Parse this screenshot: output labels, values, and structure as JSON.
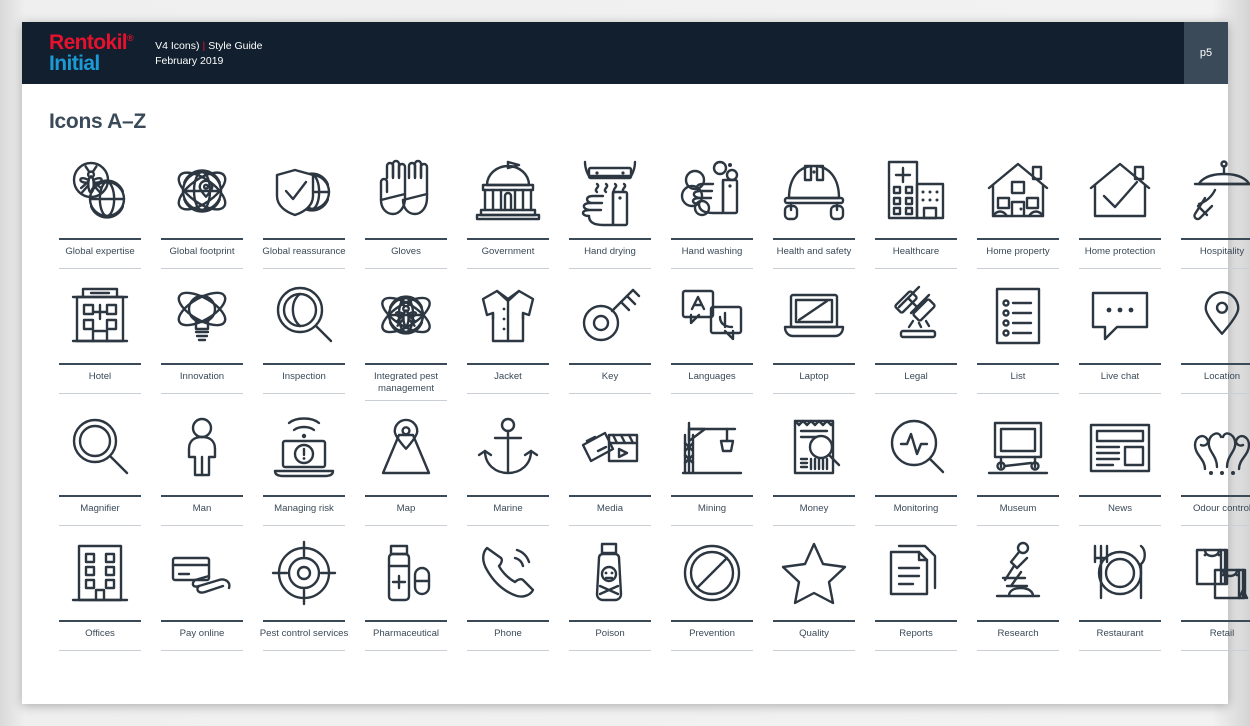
{
  "brand": {
    "line1": "Rentokil",
    "trademark": "®",
    "line2": "Initial"
  },
  "header": {
    "doc_label": "V4 Icons)",
    "separator": "|",
    "doc_type": "Style Guide",
    "date": "February 2019",
    "page_number": "p5",
    "bg_color": "#111f2e",
    "page_block_color": "#3a4a58",
    "brand_red": "#e8112d",
    "brand_blue": "#1c9ad6"
  },
  "main": {
    "title": "Icons A–Z",
    "ink_color": "#2c3742",
    "label_color": "#3a4a58"
  },
  "icons": [
    {
      "label": "Global expertise",
      "name": "global-expertise-icon"
    },
    {
      "label": "Global footprint",
      "name": "global-footprint-icon"
    },
    {
      "label": "Global reassurance",
      "name": "global-reassurance-icon"
    },
    {
      "label": "Gloves",
      "name": "gloves-icon"
    },
    {
      "label": "Government",
      "name": "government-icon"
    },
    {
      "label": "Hand drying",
      "name": "hand-drying-icon"
    },
    {
      "label": "Hand washing",
      "name": "hand-washing-icon"
    },
    {
      "label": "Health and safety",
      "name": "health-and-safety-icon"
    },
    {
      "label": "Healthcare",
      "name": "healthcare-icon"
    },
    {
      "label": "Home property",
      "name": "home-property-icon"
    },
    {
      "label": "Home protection",
      "name": "home-protection-icon"
    },
    {
      "label": "Hospitality",
      "name": "hospitality-icon"
    },
    {
      "label": "Hotel",
      "name": "hotel-icon"
    },
    {
      "label": "Innovation",
      "name": "innovation-icon"
    },
    {
      "label": "Inspection",
      "name": "inspection-icon"
    },
    {
      "label": "Integrated pest management",
      "name": "integrated-pest-management-icon"
    },
    {
      "label": "Jacket",
      "name": "jacket-icon"
    },
    {
      "label": "Key",
      "name": "key-icon"
    },
    {
      "label": "Languages",
      "name": "languages-icon"
    },
    {
      "label": "Laptop",
      "name": "laptop-icon"
    },
    {
      "label": "Legal",
      "name": "legal-icon"
    },
    {
      "label": "List",
      "name": "list-icon"
    },
    {
      "label": "Live chat",
      "name": "live-chat-icon"
    },
    {
      "label": "Location",
      "name": "location-icon"
    },
    {
      "label": "Magnifier",
      "name": "magnifier-icon"
    },
    {
      "label": "Man",
      "name": "man-icon"
    },
    {
      "label": "Managing risk",
      "name": "managing-risk-icon"
    },
    {
      "label": "Map",
      "name": "map-icon"
    },
    {
      "label": "Marine",
      "name": "marine-icon"
    },
    {
      "label": "Media",
      "name": "media-icon"
    },
    {
      "label": "Mining",
      "name": "mining-icon"
    },
    {
      "label": "Money",
      "name": "money-icon"
    },
    {
      "label": "Monitoring",
      "name": "monitoring-icon"
    },
    {
      "label": "Museum",
      "name": "museum-icon"
    },
    {
      "label": "News",
      "name": "news-icon"
    },
    {
      "label": "Odour control",
      "name": "odour-control-icon"
    },
    {
      "label": "Offices",
      "name": "offices-icon"
    },
    {
      "label": "Pay online",
      "name": "pay-online-icon"
    },
    {
      "label": "Pest control services",
      "name": "pest-control-services-icon"
    },
    {
      "label": "Pharmaceutical",
      "name": "pharmaceutical-icon"
    },
    {
      "label": "Phone",
      "name": "phone-icon"
    },
    {
      "label": "Poison",
      "name": "poison-icon"
    },
    {
      "label": "Prevention",
      "name": "prevention-icon"
    },
    {
      "label": "Quality",
      "name": "quality-icon"
    },
    {
      "label": "Reports",
      "name": "reports-icon"
    },
    {
      "label": "Research",
      "name": "research-icon"
    },
    {
      "label": "Restaurant",
      "name": "restaurant-icon"
    },
    {
      "label": "Retail",
      "name": "retail-icon"
    }
  ]
}
